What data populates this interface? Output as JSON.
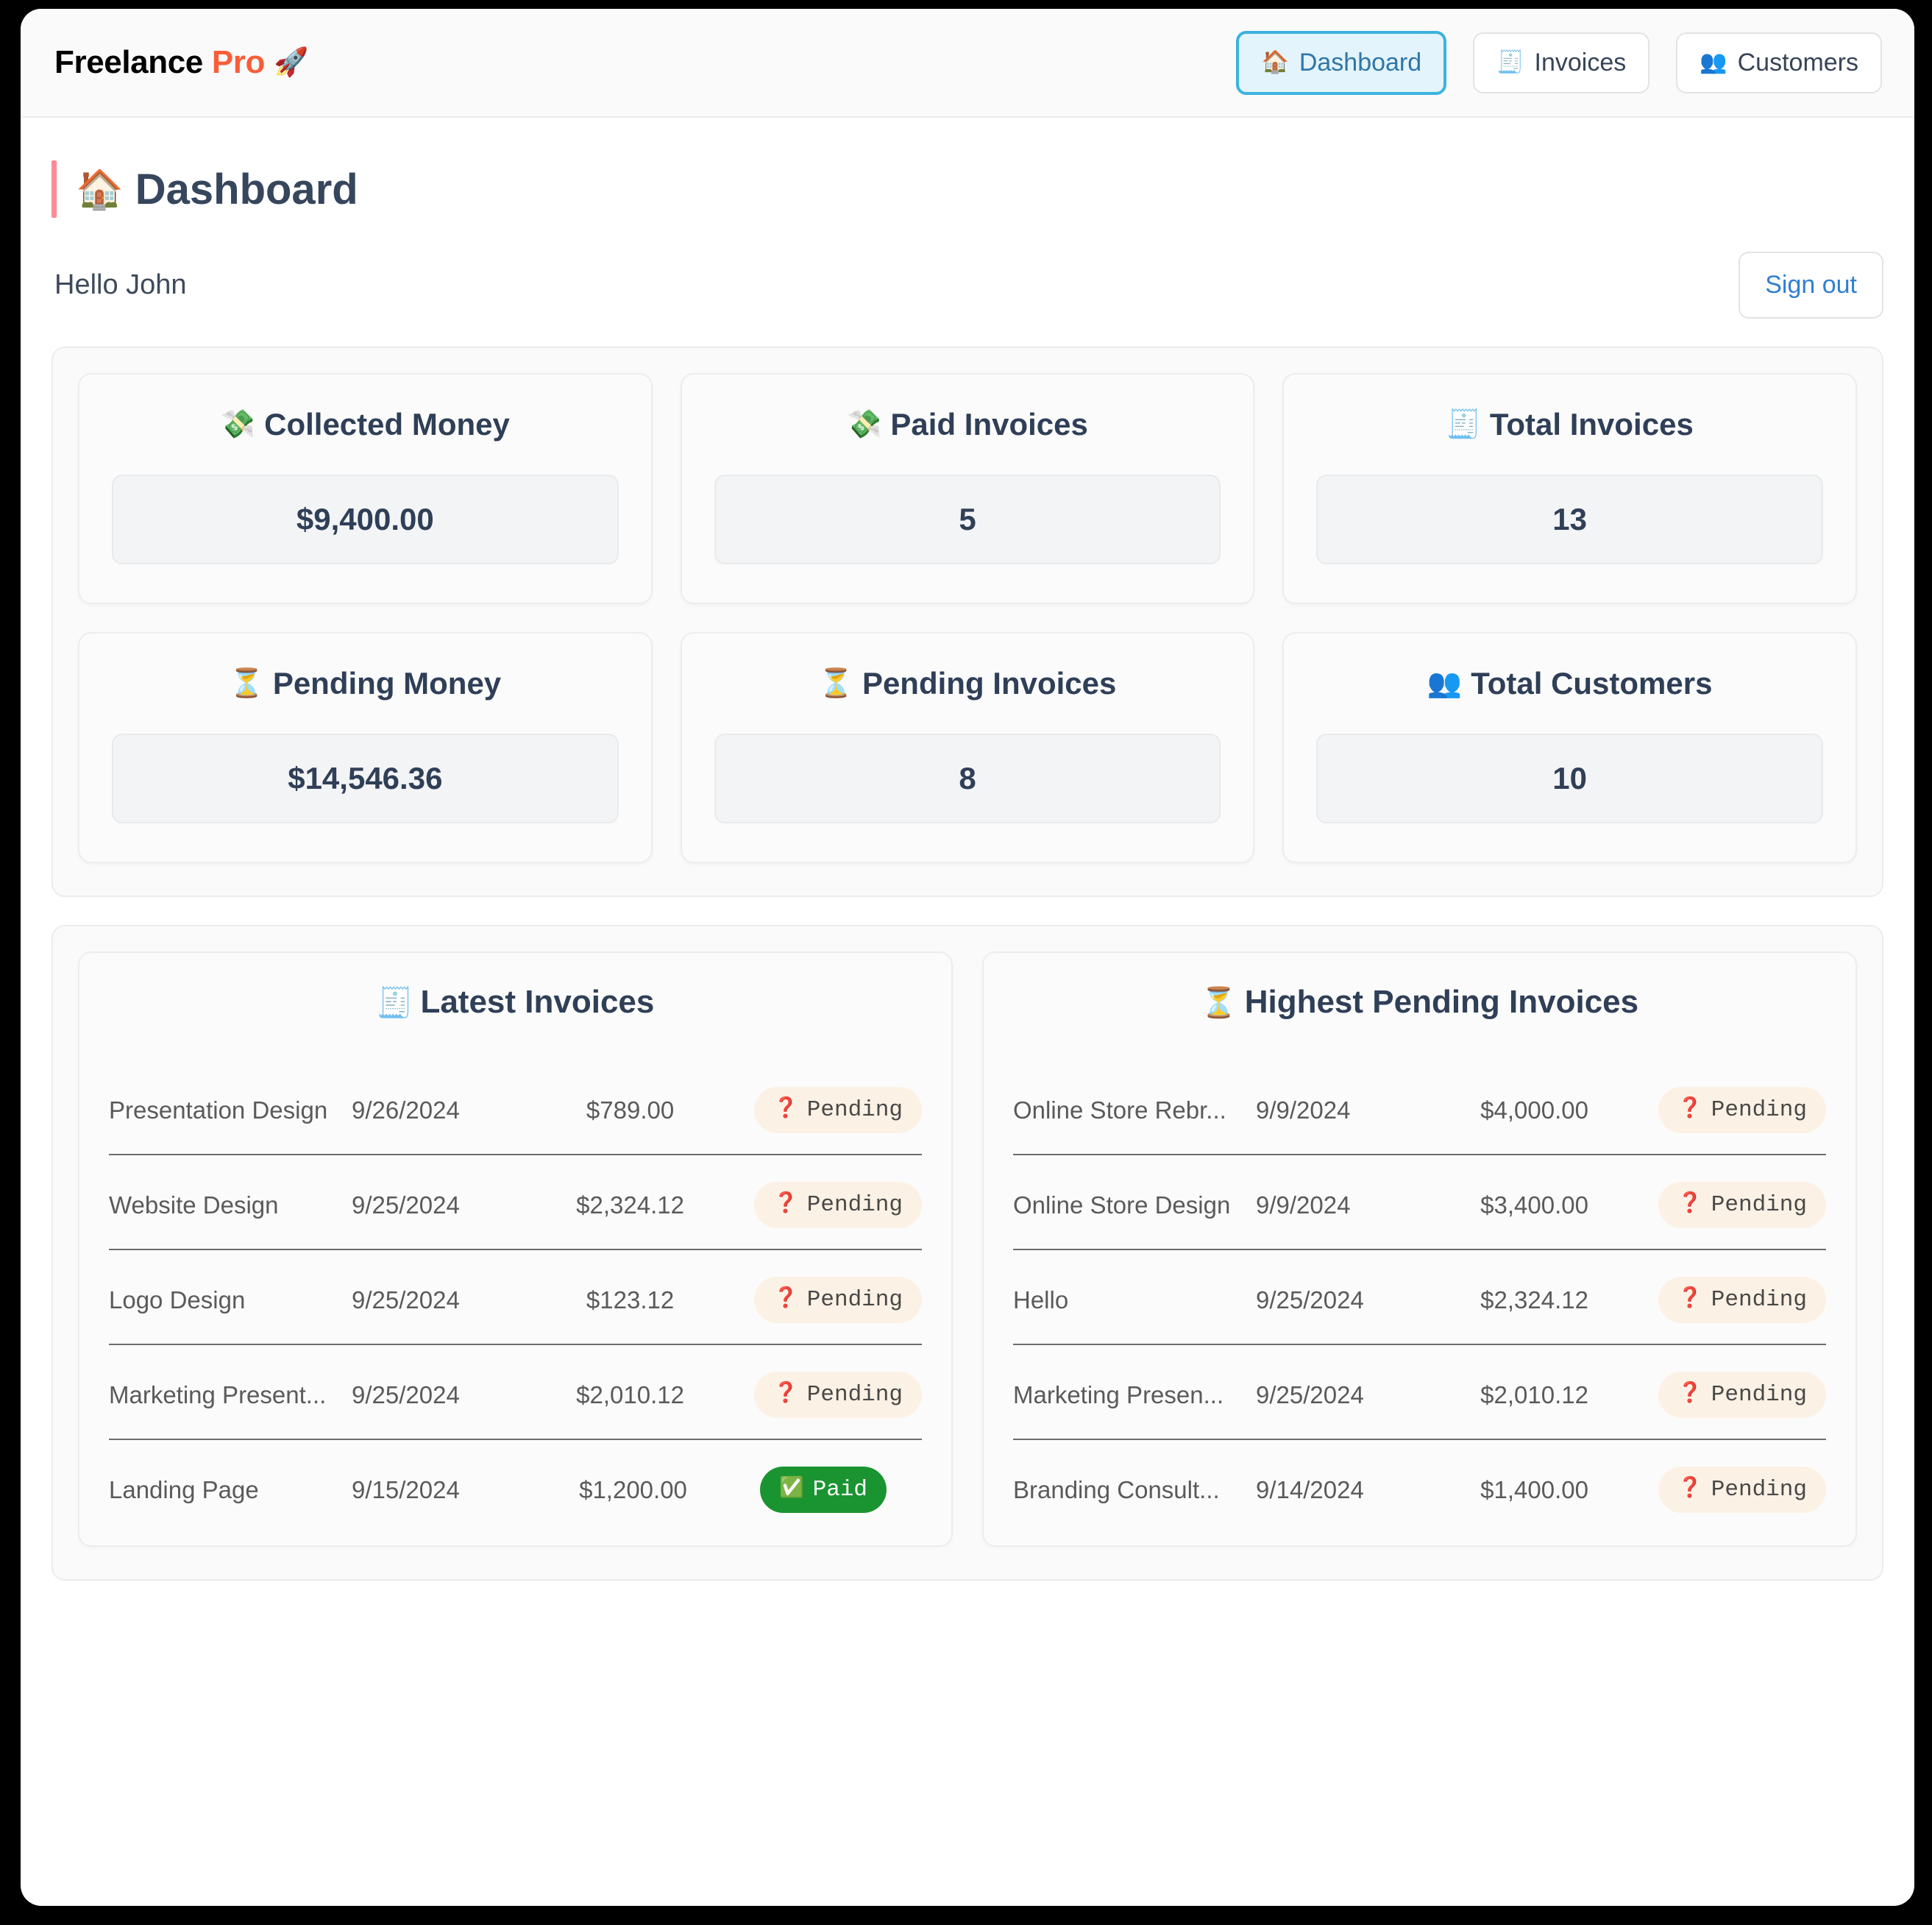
{
  "header": {
    "brand_first": "Freelance",
    "brand_second": "Pro",
    "brand_emoji": "🚀",
    "nav": [
      {
        "label": "Dashboard",
        "icon": "🏠",
        "icon_name": "home-icon",
        "active": true
      },
      {
        "label": "Invoices",
        "icon": "🧾",
        "icon_name": "invoice-icon",
        "active": false
      },
      {
        "label": "Customers",
        "icon": "👥",
        "icon_name": "customers-icon",
        "active": false
      }
    ]
  },
  "page": {
    "title": "Dashboard",
    "title_icon": "🏠",
    "accent_bar_color": "#fc8b96",
    "greeting": "Hello John",
    "signout_label": "Sign out",
    "signout_color": "#2f7fd0"
  },
  "stats": [
    {
      "title": "Collected Money",
      "icon": "💸",
      "icon_name": "money-hand-icon",
      "value": "$9,400.00"
    },
    {
      "title": "Paid Invoices",
      "icon": "💸",
      "icon_name": "money-hand-icon",
      "value": "5"
    },
    {
      "title": "Total Invoices",
      "icon": "🧾",
      "icon_name": "invoice-icon",
      "value": "13"
    },
    {
      "title": "Pending Money",
      "icon": "⏳",
      "icon_name": "hourglass-icon",
      "value": "$14,546.36"
    },
    {
      "title": "Pending Invoices",
      "icon": "⏳",
      "icon_name": "hourglass-icon",
      "value": "8"
    },
    {
      "title": "Total Customers",
      "icon": "👥",
      "icon_name": "customers-icon",
      "value": "10"
    }
  ],
  "panels": [
    {
      "title": "Latest Invoices",
      "icon": "🧾",
      "icon_name": "invoice-icon",
      "rows": [
        {
          "name": "Presentation Design",
          "date": "9/26/2024",
          "amount": "$789.00",
          "status": "Pending",
          "status_icon": "❓"
        },
        {
          "name": "Website Design",
          "date": "9/25/2024",
          "amount": "$2,324.12",
          "status": "Pending",
          "status_icon": "❓"
        },
        {
          "name": "Logo Design",
          "date": "9/25/2024",
          "amount": "$123.12",
          "status": "Pending",
          "status_icon": "❓"
        },
        {
          "name": "Marketing Present...",
          "date": "9/25/2024",
          "amount": "$2,010.12",
          "status": "Pending",
          "status_icon": "❓"
        },
        {
          "name": "Landing Page",
          "date": "9/15/2024",
          "amount": "$1,200.00",
          "status": "Paid",
          "status_icon": "✅"
        }
      ]
    },
    {
      "title": "Highest Pending Invoices",
      "icon": "⏳",
      "icon_name": "hourglass-icon",
      "rows": [
        {
          "name": "Online Store Rebr...",
          "date": "9/9/2024",
          "amount": "$4,000.00",
          "status": "Pending",
          "status_icon": "❓"
        },
        {
          "name": "Online Store Design",
          "date": "9/9/2024",
          "amount": "$3,400.00",
          "status": "Pending",
          "status_icon": "❓"
        },
        {
          "name": "Hello",
          "date": "9/25/2024",
          "amount": "$2,324.12",
          "status": "Pending",
          "status_icon": "❓"
        },
        {
          "name": "Marketing Presen...",
          "date": "9/25/2024",
          "amount": "$2,010.12",
          "status": "Pending",
          "status_icon": "❓"
        },
        {
          "name": "Branding Consult...",
          "date": "9/14/2024",
          "amount": "$1,400.00",
          "status": "Pending",
          "status_icon": "❓"
        }
      ]
    }
  ],
  "colors": {
    "brand_dark": "#2d3e54",
    "brand_accent": "#f95d38",
    "nav_active_bg": "#e3f4fc",
    "nav_active_border": "#3cb3dd",
    "paid_green": "#1a9431",
    "pending_peach": "#fcf1e5"
  }
}
